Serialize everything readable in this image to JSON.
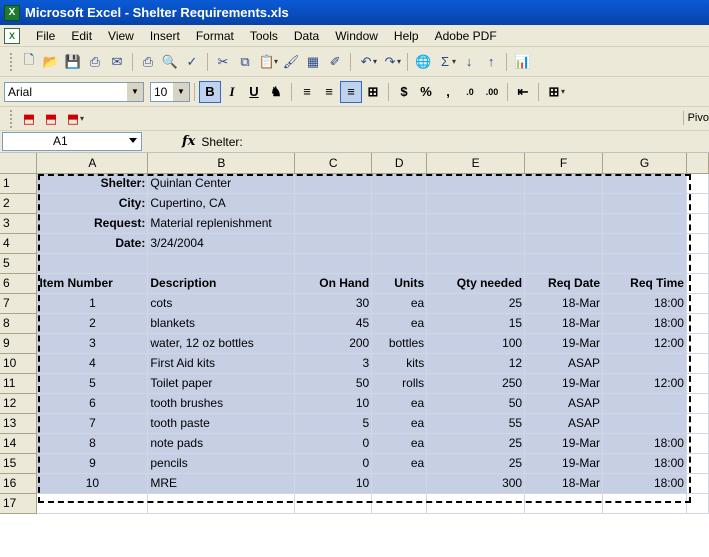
{
  "window": {
    "title": "Microsoft Excel - Shelter Requirements.xls"
  },
  "menu": [
    "File",
    "Edit",
    "View",
    "Insert",
    "Format",
    "Tools",
    "Data",
    "Window",
    "Help",
    "Adobe PDF"
  ],
  "format_toolbar": {
    "font_name": "Arial",
    "font_size": "10",
    "pivot_label": "Pivo"
  },
  "formula_bar": {
    "name_box": "A1",
    "fx_label": "fx",
    "content": "Shelter:"
  },
  "columns": [
    "A",
    "B",
    "C",
    "D",
    "E",
    "F",
    "G"
  ],
  "rows": [
    {
      "n": "1",
      "a": "Shelter:",
      "b": "Quinlan Center",
      "c": "",
      "d": "",
      "e": "",
      "f": "",
      "g": ""
    },
    {
      "n": "2",
      "a": "City:",
      "b": "Cupertino, CA",
      "c": "",
      "d": "",
      "e": "",
      "f": "",
      "g": ""
    },
    {
      "n": "3",
      "a": "Request:",
      "b": "Material replenishment",
      "c": "",
      "d": "",
      "e": "",
      "f": "",
      "g": ""
    },
    {
      "n": "4",
      "a": "Date:",
      "b": "3/24/2004",
      "c": "",
      "d": "",
      "e": "",
      "f": "",
      "g": ""
    },
    {
      "n": "5",
      "a": "",
      "b": "",
      "c": "",
      "d": "",
      "e": "",
      "f": "",
      "g": ""
    },
    {
      "n": "6",
      "a": "Item Number",
      "b": "Description",
      "c": "On Hand",
      "d": "Units",
      "e": "Qty needed",
      "f": "Req Date",
      "g": "Req Time"
    },
    {
      "n": "7",
      "a": "1",
      "b": "cots",
      "c": "30",
      "d": "ea",
      "e": "25",
      "f": "18-Mar",
      "g": "18:00"
    },
    {
      "n": "8",
      "a": "2",
      "b": "blankets",
      "c": "45",
      "d": "ea",
      "e": "15",
      "f": "18-Mar",
      "g": "18:00"
    },
    {
      "n": "9",
      "a": "3",
      "b": "water, 12 oz bottles",
      "c": "200",
      "d": "bottles",
      "e": "100",
      "f": "19-Mar",
      "g": "12:00"
    },
    {
      "n": "10",
      "a": "4",
      "b": "First Aid kits",
      "c": "3",
      "d": "kits",
      "e": "12",
      "f": "ASAP",
      "g": ""
    },
    {
      "n": "11",
      "a": "5",
      "b": "Toilet paper",
      "c": "50",
      "d": "rolls",
      "e": "250",
      "f": "19-Mar",
      "g": "12:00"
    },
    {
      "n": "12",
      "a": "6",
      "b": "tooth brushes",
      "c": "10",
      "d": "ea",
      "e": "50",
      "f": "ASAP",
      "g": ""
    },
    {
      "n": "13",
      "a": "7",
      "b": "tooth paste",
      "c": "5",
      "d": "ea",
      "e": "55",
      "f": "ASAP",
      "g": ""
    },
    {
      "n": "14",
      "a": "8",
      "b": "note pads",
      "c": "0",
      "d": "ea",
      "e": "25",
      "f": "19-Mar",
      "g": "18:00"
    },
    {
      "n": "15",
      "a": "9",
      "b": "pencils",
      "c": "0",
      "d": "ea",
      "e": "25",
      "f": "19-Mar",
      "g": "18:00"
    },
    {
      "n": "16",
      "a": "10",
      "b": "MRE",
      "c": "10",
      "d": "",
      "e": "300",
      "f": "18-Mar",
      "g": "18:00"
    },
    {
      "n": "17",
      "a": "",
      "b": "",
      "c": "",
      "d": "",
      "e": "",
      "f": "",
      "g": ""
    }
  ]
}
